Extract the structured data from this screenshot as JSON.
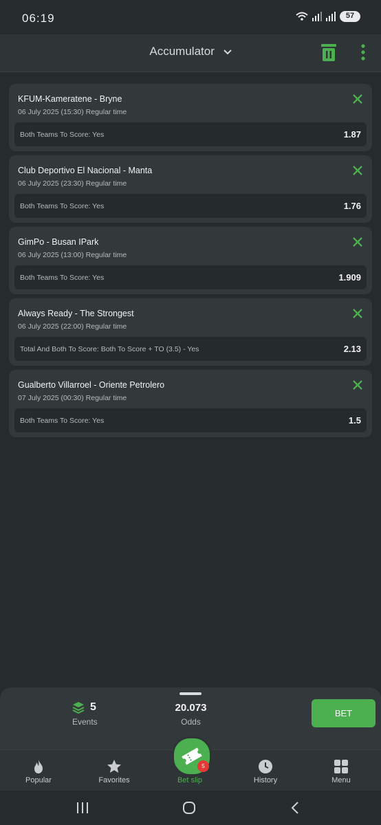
{
  "status_bar": {
    "time": "06:19",
    "battery": "57"
  },
  "header": {
    "title": "Accumulator"
  },
  "bets": [
    {
      "match": "KFUM-Kameratene - Bryne",
      "date": "06 July 2025 (15:30) Regular time",
      "pick": "Both Teams To Score: Yes",
      "odds": "1.87"
    },
    {
      "match": "Club Deportivo El Nacional - Manta",
      "date": "06 July 2025 (23:30) Regular time",
      "pick": "Both Teams To Score: Yes",
      "odds": "1.76"
    },
    {
      "match": "GimPo - Busan IPark",
      "date": "06 July 2025 (13:00) Regular time",
      "pick": "Both Teams To Score: Yes",
      "odds": "1.909"
    },
    {
      "match": "Always Ready - The Strongest",
      "date": "06 July 2025 (22:00) Regular time",
      "pick": "Total And Both To Score: Both To Score + TO (3.5) - Yes",
      "odds": "2.13"
    },
    {
      "match": "Gualberto Villarroel - Oriente Petrolero",
      "date": "07 July 2025 (00:30) Regular time",
      "pick": "Both Teams To Score: Yes",
      "odds": "1.5"
    }
  ],
  "summary": {
    "events_count": "5",
    "events_label": "Events",
    "odds_value": "20.073",
    "odds_label": "Odds",
    "bet_label": "BET"
  },
  "tabs": [
    {
      "label": "Popular",
      "icon": "fire-icon"
    },
    {
      "label": "Favorites",
      "icon": "star-icon"
    },
    {
      "label": "Bet slip",
      "icon": "ticket-icon",
      "badge": "5"
    },
    {
      "label": "History",
      "icon": "clock-icon"
    },
    {
      "label": "Menu",
      "icon": "grid-icon"
    }
  ],
  "colors": {
    "accent": "#4caf50",
    "background": "#262b2d",
    "card": "#33383b",
    "badge": "#e53935"
  }
}
